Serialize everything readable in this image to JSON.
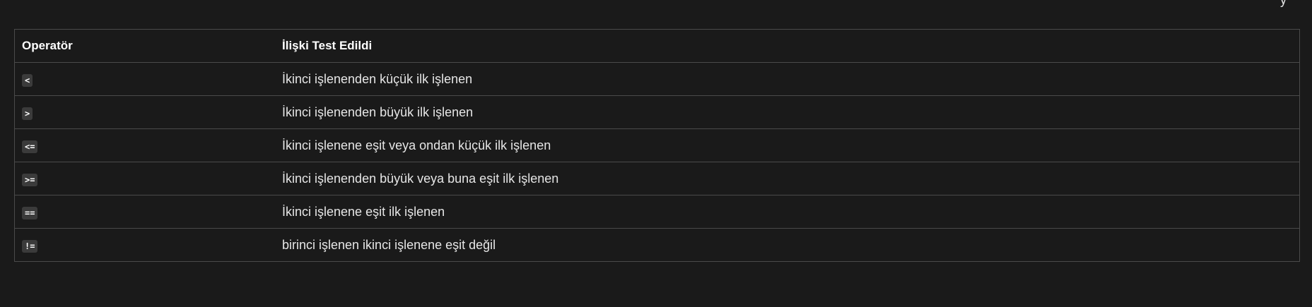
{
  "top_fragment": "y",
  "table": {
    "headers": {
      "operator": "Operatör",
      "relation": "İlişki Test Edildi"
    },
    "rows": [
      {
        "operator": "<",
        "relation": "İkinci işlenenden küçük ilk işlenen"
      },
      {
        "operator": ">",
        "relation": "İkinci işlenenden büyük ilk işlenen"
      },
      {
        "operator": "<=",
        "relation": "İkinci işlenene eşit veya ondan küçük ilk işlenen"
      },
      {
        "operator": ">=",
        "relation": "İkinci işlenenden büyük veya buna eşit ilk işlenen"
      },
      {
        "operator": "==",
        "relation": "İkinci işlenene eşit ilk işlenen"
      },
      {
        "operator": "!=",
        "relation": "birinci işlenen ikinci işlenene eşit değil"
      }
    ]
  }
}
